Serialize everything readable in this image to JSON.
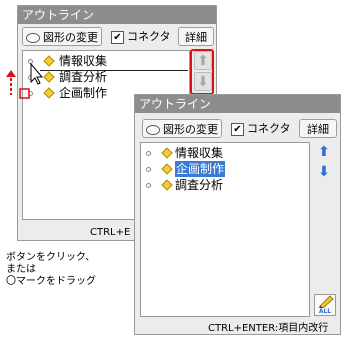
{
  "panel_before": {
    "title": "アウトライン",
    "shape_button": "図形の変更",
    "connector_label": "コネクタ",
    "connector_check": "✔",
    "detail_button": "詳細",
    "items": [
      "情報収集",
      "調査分析",
      "企画制作"
    ],
    "up_arrow": "⬆",
    "down_arrow": "⬇",
    "footer": "CTRL+E"
  },
  "panel_after": {
    "title": "アウトライン",
    "shape_button": "図形の変更",
    "connector_label": "コネクタ",
    "connector_check": "✔",
    "detail_button": "詳細",
    "items": [
      "情報収集",
      "企画制作",
      "調査分析"
    ],
    "selected_index": 1,
    "up_arrow": "⬆",
    "down_arrow": "⬇",
    "all_label": "ALL",
    "footer": "CTRL+ENTER:項目内改行"
  },
  "caption": {
    "line1": "ボタンをクリック、",
    "line2": "または",
    "line3": "〇マークをドラッグ"
  },
  "colors": {
    "title_bar": "#8d8d8d",
    "highlight": "#3b7bd6",
    "callout_red": "#dd1111",
    "accent_blue": "#2c6fd1",
    "bullet_yellow": "#f4cc3a"
  }
}
